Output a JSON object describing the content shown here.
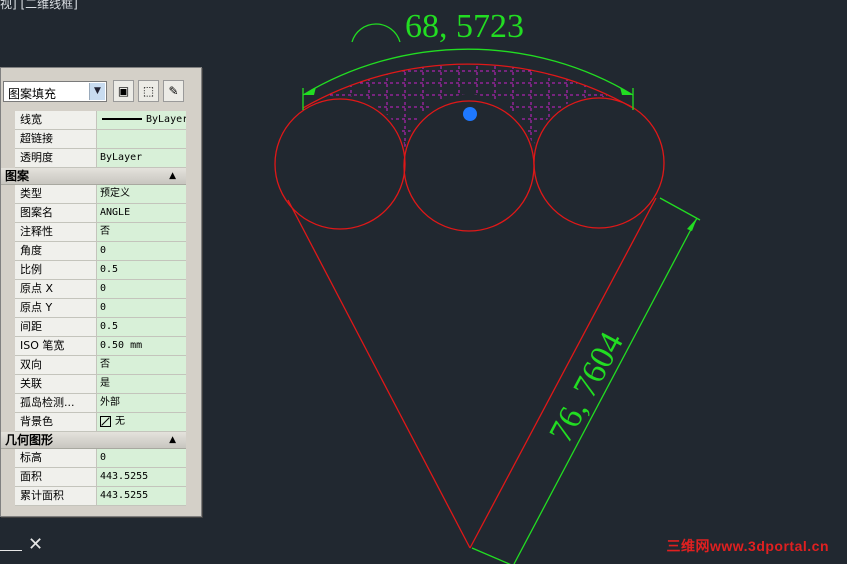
{
  "viewport": {
    "label": "视] [二维线框]"
  },
  "drawing": {
    "dim_arc_text": "68, 5723",
    "dim_aligned_text": "76, 7604",
    "colors": {
      "outline": "#e01818",
      "dimension": "#22dd22",
      "hatch": "#cc22cc",
      "grip": "#1e78ff"
    }
  },
  "palette": {
    "object_type": "图案填充",
    "toolbar_icons": [
      "quick-select-icon",
      "select-objects-icon",
      "toggle-pickadd-icon"
    ],
    "top_rows": [
      {
        "key": "线宽",
        "value": "ByLayer"
      },
      {
        "key": "超链接",
        "value": ""
      },
      {
        "key": "透明度",
        "value": "ByLayer"
      }
    ],
    "pattern_section": "图案",
    "pattern_rows": [
      {
        "key": "类型",
        "value": "预定义"
      },
      {
        "key": "图案名",
        "value": "ANGLE"
      },
      {
        "key": "注释性",
        "value": "否"
      },
      {
        "key": "角度",
        "value": "0"
      },
      {
        "key": "比例",
        "value": "0.5"
      },
      {
        "key": "原点 X",
        "value": "0"
      },
      {
        "key": "原点 Y",
        "value": "0"
      },
      {
        "key": "间距",
        "value": "0.5"
      },
      {
        "key": "ISO 笔宽",
        "value": "0.50 mm"
      },
      {
        "key": "双向",
        "value": "否"
      },
      {
        "key": "关联",
        "value": "是"
      },
      {
        "key": "孤岛检测...",
        "value": "外部"
      },
      {
        "key": "背景色",
        "value": "无"
      }
    ],
    "geometry_section": "几何图形",
    "geometry_rows": [
      {
        "key": "标高",
        "value": "0"
      },
      {
        "key": "面积",
        "value": "443.5255"
      },
      {
        "key": "累计面积",
        "value": "443.5255"
      }
    ]
  },
  "ucs": {
    "x_glyph": "✕"
  },
  "watermark": "三维网www.3dportal.cn"
}
